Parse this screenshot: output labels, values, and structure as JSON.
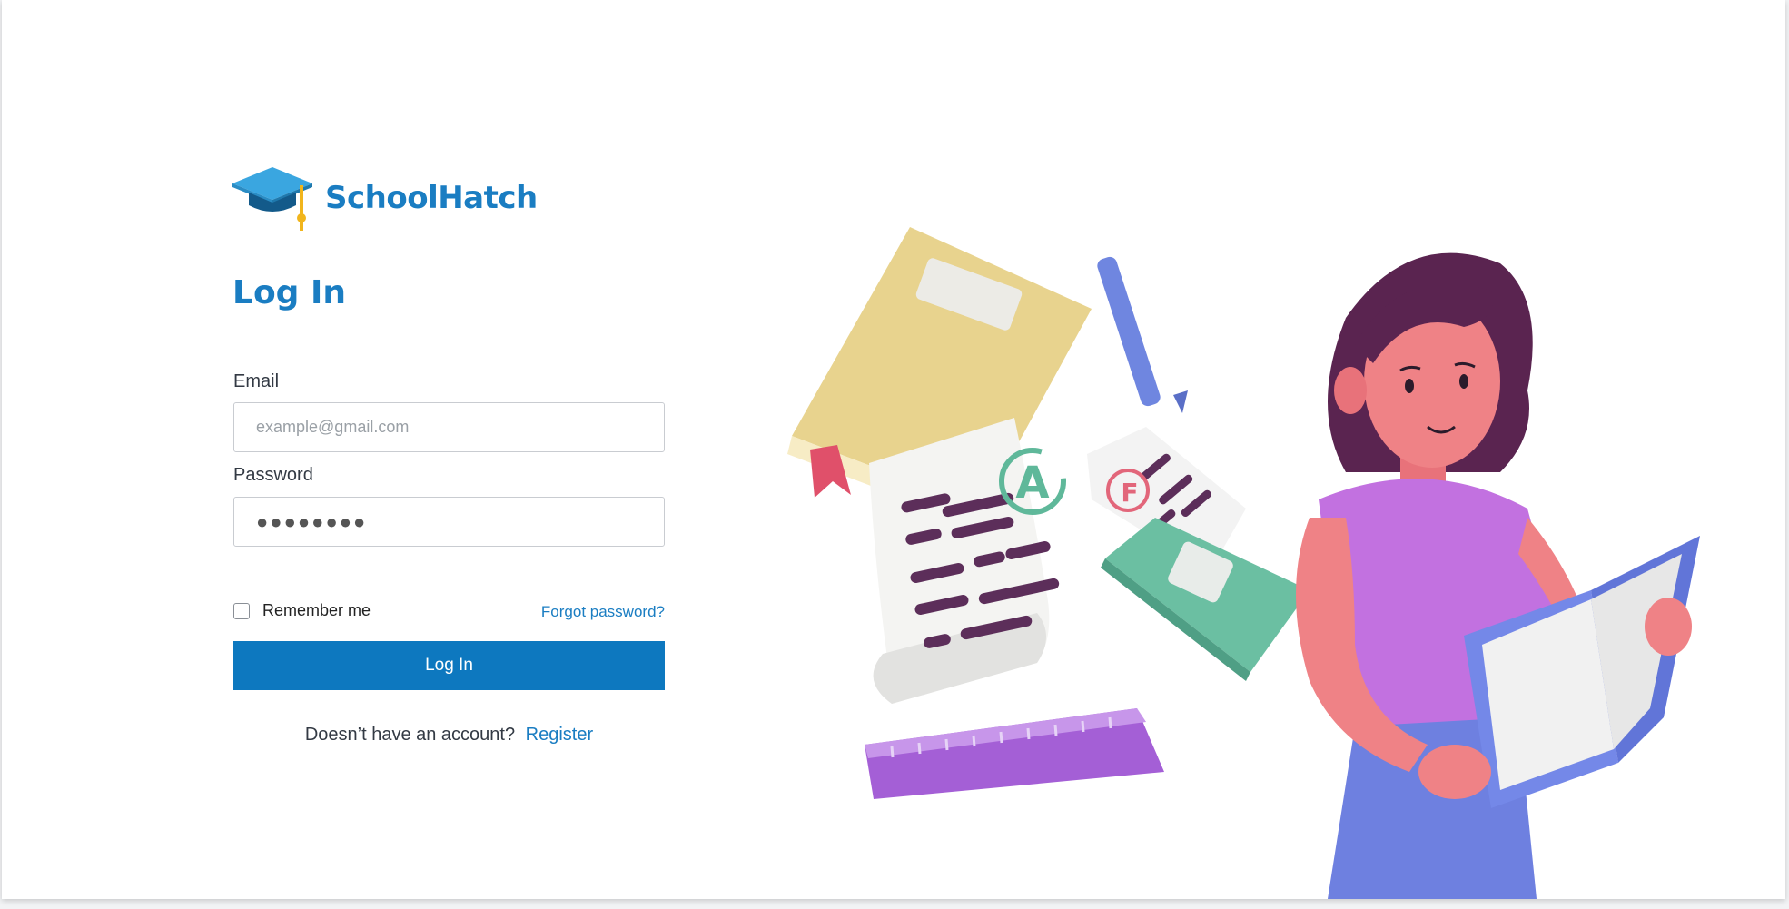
{
  "brand": {
    "name": "SchoolHatch",
    "logo_icon": "graduation-cap-icon",
    "color": "#1a7dc2"
  },
  "page": {
    "title": "Log In"
  },
  "form": {
    "email": {
      "label": "Email",
      "placeholder": "example@gmail.com",
      "value": ""
    },
    "password": {
      "label": "Password",
      "masked_value": "●●●●●●●●"
    },
    "remember_me": {
      "label": "Remember me",
      "checked": false
    },
    "forgot_password": "Forgot password?",
    "submit_label": "Log In",
    "register_prompt": "Doesn’t have an account?",
    "register_link": "Register"
  },
  "colors": {
    "accent": "#1a7dc2",
    "button": "#0d78bf"
  },
  "illustration": {
    "icon": "student-reading-illustration"
  }
}
